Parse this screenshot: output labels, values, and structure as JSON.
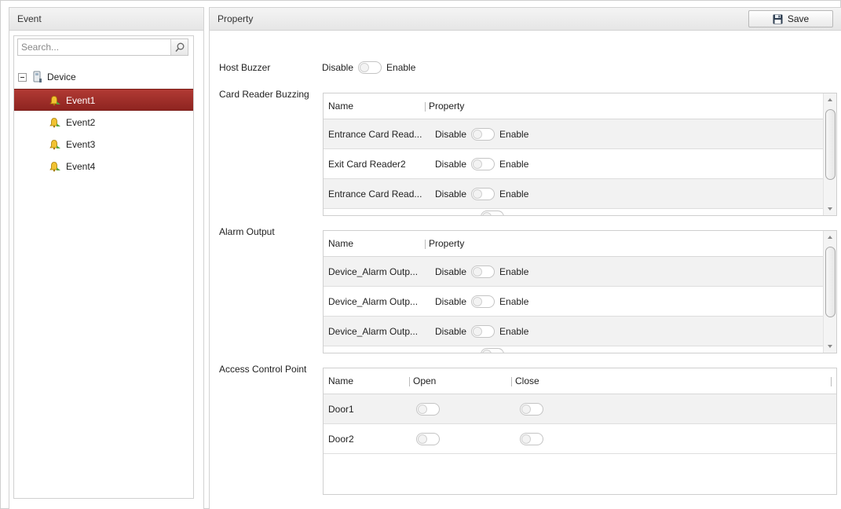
{
  "left": {
    "header": "Event",
    "search_placeholder": "Search...",
    "tree_root": "Device",
    "events": [
      {
        "label": "Event1",
        "selected": true
      },
      {
        "label": "Event2",
        "selected": false
      },
      {
        "label": "Event3",
        "selected": false
      },
      {
        "label": "Event4",
        "selected": false
      }
    ]
  },
  "right": {
    "header": "Property",
    "save_label": "Save",
    "host_buzzer": {
      "label": "Host Buzzer",
      "disable": "Disable",
      "enable": "Enable"
    },
    "card_reader": {
      "label": "Card Reader Buzzing",
      "col_name": "Name",
      "col_property": "Property",
      "rows": [
        {
          "name": "Entrance Card Read...",
          "disable": "Disable",
          "enable": "Enable"
        },
        {
          "name": "Exit Card Reader2",
          "disable": "Disable",
          "enable": "Enable"
        },
        {
          "name": "Entrance Card Read...",
          "disable": "Disable",
          "enable": "Enable"
        }
      ]
    },
    "alarm_output": {
      "label": "Alarm Output",
      "col_name": "Name",
      "col_property": "Property",
      "rows": [
        {
          "name": "Device_Alarm Outp...",
          "disable": "Disable",
          "enable": "Enable"
        },
        {
          "name": "Device_Alarm Outp...",
          "disable": "Disable",
          "enable": "Enable"
        },
        {
          "name": "Device_Alarm Outp...",
          "disable": "Disable",
          "enable": "Enable"
        }
      ]
    },
    "access_control": {
      "label": "Access Control Point",
      "col_name": "Name",
      "col_open": "Open",
      "col_close": "Close",
      "rows": [
        {
          "name": "Door1"
        },
        {
          "name": "Door2"
        }
      ]
    }
  },
  "colors": {
    "selected_row": "#9e2d28",
    "header_bg": "#e9e9e9",
    "border": "#d2d2d2"
  }
}
